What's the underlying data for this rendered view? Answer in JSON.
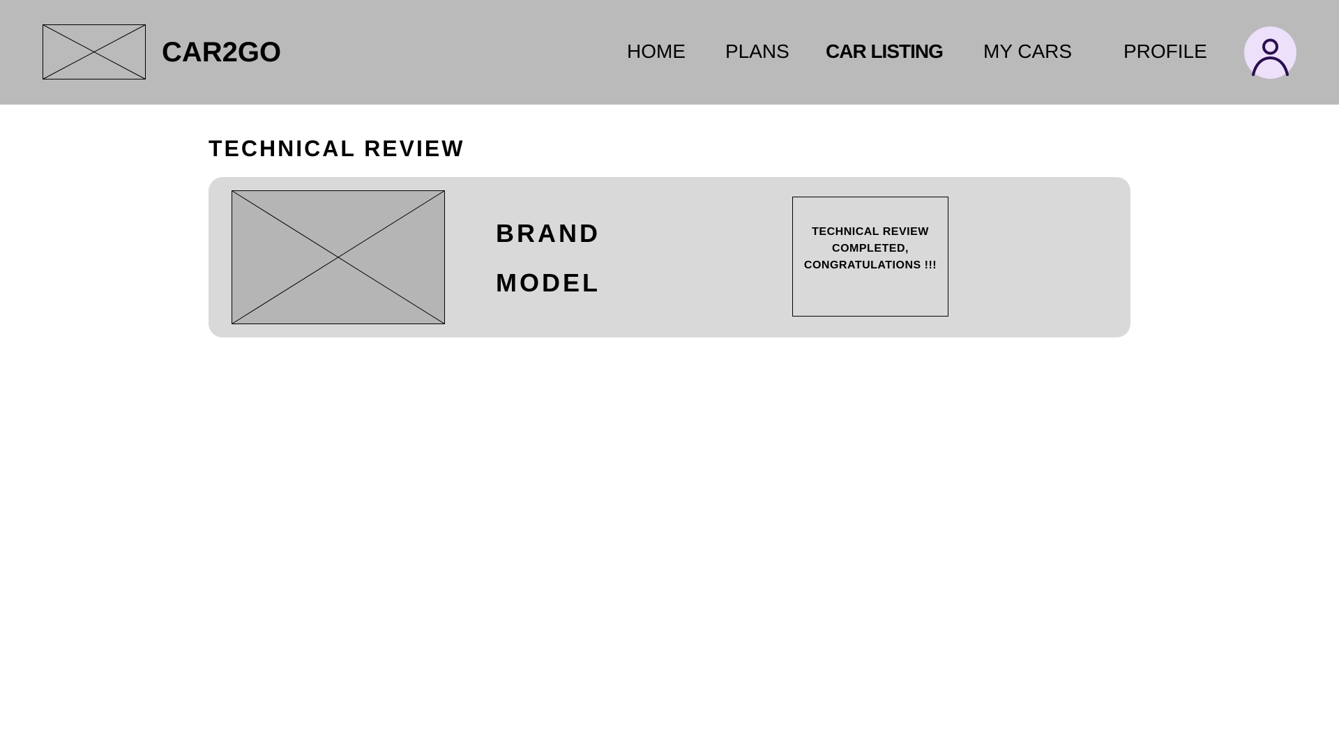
{
  "header": {
    "brand_name": "CAR2GO",
    "nav": {
      "home": "HOME",
      "plans": "PLANS",
      "car_listing": "CAR LISTING",
      "my_cars": "MY CARS",
      "profile": "PROFILE"
    },
    "active_nav": "car_listing",
    "avatar_icon": "user-icon"
  },
  "main": {
    "title": "TECHNICAL REVIEW",
    "card": {
      "brand": "BRAND",
      "model": "MODEL",
      "status_message": "TECHNICAL REVIEW COMPLETED, CONGRATULATIONS !!!"
    }
  },
  "colors": {
    "header_bg": "#bababa",
    "card_bg": "#d9d9d9",
    "image_placeholder_bg": "#b5b5b5",
    "avatar_bg": "#ede0fb",
    "avatar_icon": "#2a0f4f"
  }
}
